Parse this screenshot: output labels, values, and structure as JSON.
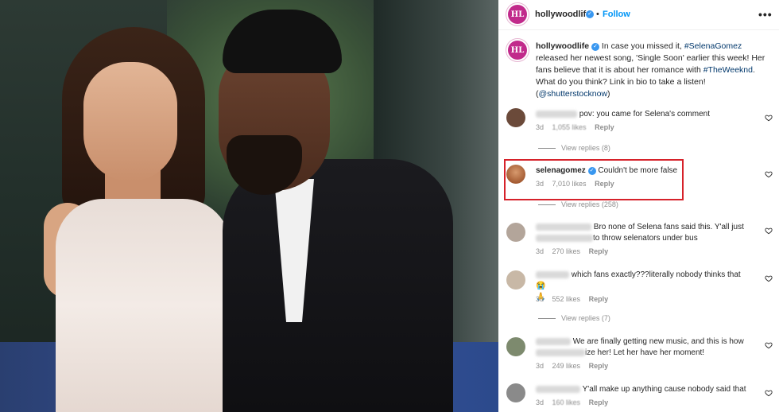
{
  "post": {
    "author": "hollywoodlife",
    "avatar_text": "HL",
    "follow_label": "Follow",
    "dot": "•",
    "more_label": "•••",
    "caption_author": "hollywoodlife",
    "caption_parts": {
      "p1": " In case you missed it, ",
      "tag1": "#SelenaGomez",
      "p2": " released her newest song, 'Single Soon' earlier this week! Her fans believe that it is about her romance with ",
      "tag2": "#TheWeeknd",
      "p3": ". What do you think? Link in bio to take a listen! (",
      "tag3": "@shutterstocknow",
      "p4": ")"
    }
  },
  "comments": [
    {
      "text": "pov: you came for Selena's comment",
      "time": "3d",
      "likes": "1,055 likes",
      "reply_label": "Reply",
      "view_replies": "View replies (8)"
    },
    {
      "username": "selenagomez",
      "text": "Couldn't be more false",
      "time": "3d",
      "likes": "7,010 likes",
      "reply_label": "Reply",
      "view_replies": "View replies (258)"
    },
    {
      "text_a": "Bro none of Selena fans said this. Y'all just",
      "text_b": "to throw selenators under bus",
      "time": "3d",
      "likes": "270 likes",
      "reply_label": "Reply"
    },
    {
      "text": "which fans exactly???literally nobody thinks that😭",
      "emoji": "🙏",
      "time": "3d",
      "likes": "552 likes",
      "reply_label": "Reply",
      "view_replies": "View replies (7)"
    },
    {
      "text_a": "We are finally getting new music, and this is how",
      "text_b": "ize her! Let her have her moment!",
      "time": "3d",
      "likes": "249 likes",
      "reply_label": "Reply"
    },
    {
      "text": "Y'all make up anything cause nobody said that",
      "time": "3d",
      "likes": "160 likes",
      "reply_label": "Reply"
    }
  ],
  "colors": {
    "brand": "#c12a8b",
    "link": "#0095f6",
    "highlight": "#d6222a"
  }
}
